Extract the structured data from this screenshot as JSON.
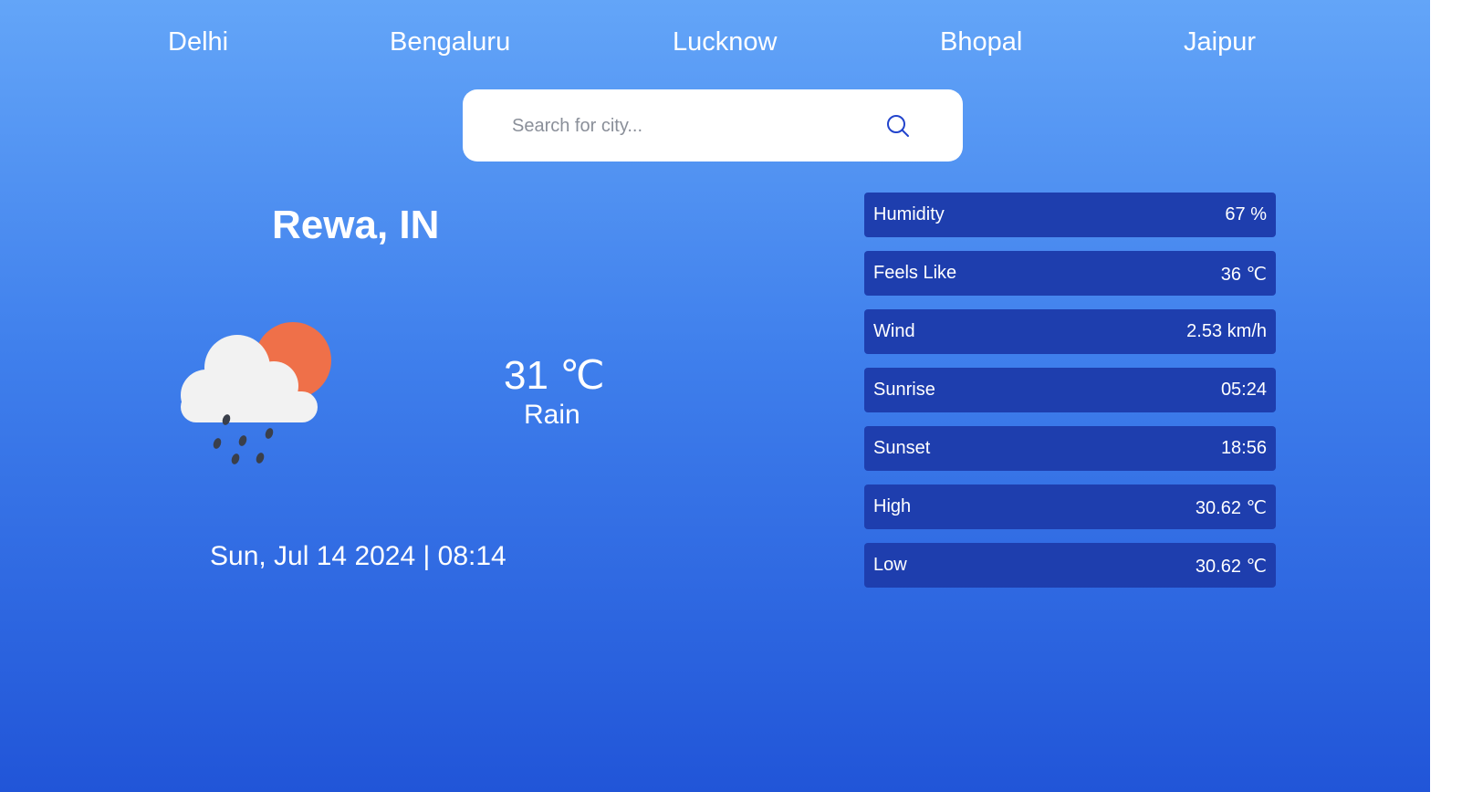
{
  "nav": {
    "cities": [
      "Delhi",
      "Bengaluru",
      "Lucknow",
      "Bhopal",
      "Jaipur"
    ]
  },
  "search": {
    "placeholder": "Search for city...",
    "value": "",
    "icon": "search-icon"
  },
  "current": {
    "location": "Rewa, IN",
    "temperature": "31",
    "temperature_unit": "℃",
    "condition": "Rain",
    "datetime": "Sun, Jul 14 2024 | 08:14",
    "icon": "cloud-sun-rain-icon"
  },
  "stats": [
    {
      "label": "Humidity",
      "value": "67 %"
    },
    {
      "label": "Feels Like",
      "value": "36 ℃"
    },
    {
      "label": "Wind",
      "value": "2.53 km/h"
    },
    {
      "label": "Sunrise",
      "value": "05:24"
    },
    {
      "label": "Sunset",
      "value": "18:56"
    },
    {
      "label": "High",
      "value": "30.62 ℃"
    },
    {
      "label": "Low",
      "value": "30.62 ℃"
    }
  ],
  "colors": {
    "background_top": "#63a5f8",
    "background_bottom": "#2155d8",
    "stat_row": "#1e3eae",
    "sun": "#ef7049",
    "search_icon": "#2244cc"
  }
}
